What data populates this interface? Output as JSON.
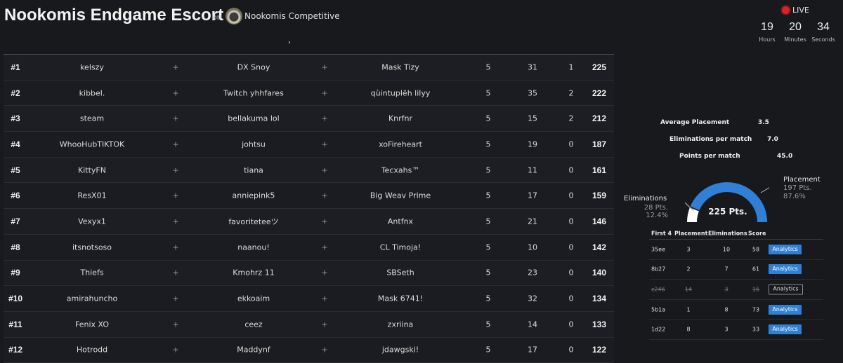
{
  "header": {
    "title": "Nookomis Endgame Escort",
    "on_label": "on",
    "org_name": "Nookomis Competitive",
    "org_logo_icon": "org-logo-icon"
  },
  "live": {
    "label": "LIVE",
    "dot_color": "#e01f2b",
    "countdown": [
      {
        "value": "19",
        "unit": "Hours"
      },
      {
        "value": "20",
        "unit": "Minutes"
      },
      {
        "value": "34",
        "unit": "Seconds"
      }
    ]
  },
  "leaderboard": {
    "separator_glyph": "+",
    "rows": [
      {
        "rank": "#1",
        "p1": "kelszy",
        "p2": "DX Snoy",
        "p3": "Mask Tizy",
        "matches": "5",
        "placement": "31",
        "elims": "1",
        "points": "225"
      },
      {
        "rank": "#2",
        "p1": "kibbel.",
        "p2": "Twitch yhhfares",
        "p3": "qùintuplëh lilyy",
        "matches": "5",
        "placement": "35",
        "elims": "2",
        "points": "222"
      },
      {
        "rank": "#3",
        "p1": "steam",
        "p2": "bellakuma lol",
        "p3": "Knrfnr",
        "matches": "5",
        "placement": "15",
        "elims": "2",
        "points": "212"
      },
      {
        "rank": "#4",
        "p1": "WhooHubTIKTOK",
        "p2": "johtsu",
        "p3": "xoFireheart",
        "matches": "5",
        "placement": "19",
        "elims": "0",
        "points": "187"
      },
      {
        "rank": "#5",
        "p1": "KittyFN",
        "p2": "tiana",
        "p3": "Tecxahs™",
        "matches": "5",
        "placement": "11",
        "elims": "0",
        "points": "161"
      },
      {
        "rank": "#6",
        "p1": "ResX01",
        "p2": "anniepink5",
        "p3": "Big Weav Prime",
        "matches": "5",
        "placement": "17",
        "elims": "0",
        "points": "159"
      },
      {
        "rank": "#7",
        "p1": "Vexyx1",
        "p2": "favoriteteeツ",
        "p3": "Antfnx",
        "matches": "5",
        "placement": "21",
        "elims": "0",
        "points": "146"
      },
      {
        "rank": "#8",
        "p1": "itsnotsoso",
        "p2": "naanou!",
        "p3": "CL Timoja!",
        "matches": "5",
        "placement": "10",
        "elims": "0",
        "points": "142"
      },
      {
        "rank": "#9",
        "p1": "Thiefs",
        "p2": "Kmohrz 11",
        "p3": "SBSeth",
        "matches": "5",
        "placement": "23",
        "elims": "0",
        "points": "140"
      },
      {
        "rank": "#10",
        "p1": "amirahuncho",
        "p2": "ekkoaim",
        "p3": "Mask 6741!",
        "matches": "5",
        "placement": "32",
        "elims": "0",
        "points": "134"
      },
      {
        "rank": "#11",
        "p1": "Fenix XO",
        "p2": "ceez",
        "p3": "zxriina",
        "matches": "5",
        "placement": "14",
        "elims": "0",
        "points": "133"
      },
      {
        "rank": "#12",
        "p1": "Hotrodd",
        "p2": "Maddynf",
        "p3": "jdawgski!",
        "matches": "5",
        "placement": "17",
        "elims": "0",
        "points": "122"
      }
    ]
  },
  "stats": {
    "avg_placement_label": "Average Placement",
    "avg_placement_value": "3.5",
    "elims_per_match_label": "Eliminations per match",
    "elims_per_match_value": "7.0",
    "points_per_match_label": "Points per match",
    "points_per_match_value": "45.0"
  },
  "gauge": {
    "total": "225 Pts.",
    "placement_color": "#2f80d6",
    "elim_color": "#ffffff",
    "placement_fraction": 0.876,
    "placement": {
      "name": "Placement",
      "points": "197 Pts.",
      "percent": "87.6%"
    },
    "eliminations": {
      "name": "Eliminations",
      "points": "28 Pts.",
      "percent": "12.4%"
    }
  },
  "matches": {
    "headers": {
      "first4": "First 4",
      "placement": "Placement",
      "eliminations": "Eliminations",
      "score": "Score"
    },
    "button_label": "Analytics",
    "button_color": "#2f80d6",
    "rows": [
      {
        "id": "35ee",
        "placement": "3",
        "eliminations": "10",
        "score": "58",
        "counted": true
      },
      {
        "id": "8b27",
        "placement": "2",
        "eliminations": "7",
        "score": "61",
        "counted": true
      },
      {
        "id": "c246",
        "placement": "14",
        "eliminations": "3",
        "score": "15",
        "counted": false
      },
      {
        "id": "5b1a",
        "placement": "1",
        "eliminations": "8",
        "score": "73",
        "counted": true
      },
      {
        "id": "1d22",
        "placement": "8",
        "eliminations": "3",
        "score": "33",
        "counted": true
      }
    ]
  }
}
